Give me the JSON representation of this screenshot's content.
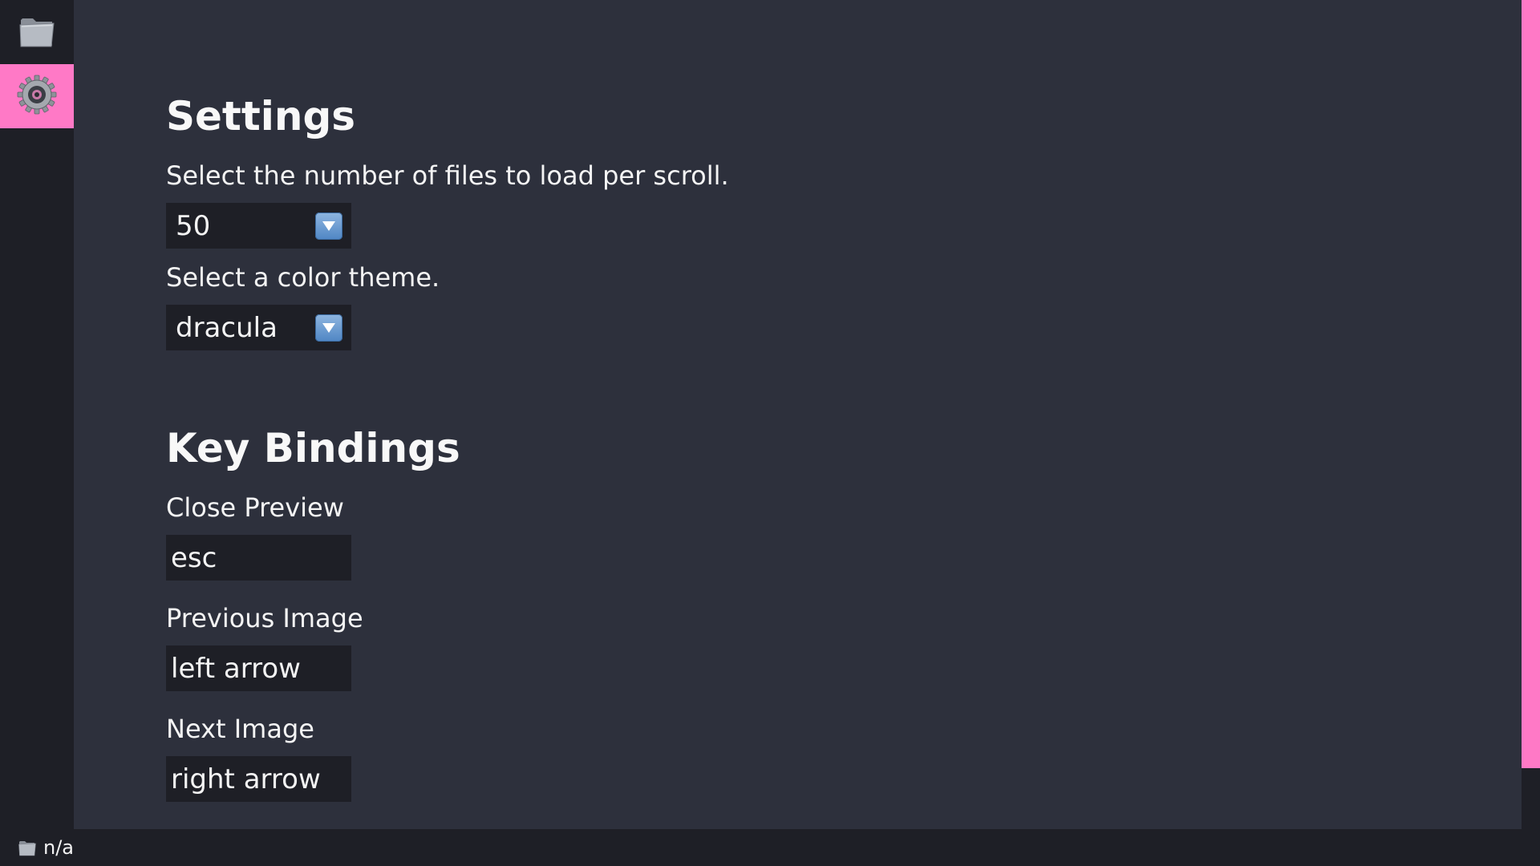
{
  "sidebar": {
    "items": [
      {
        "icon": "folder-icon"
      },
      {
        "icon": "gear-icon",
        "active": true
      }
    ]
  },
  "settings": {
    "title": "Settings",
    "files_per_scroll": {
      "label": "Select the number of files to load per scroll.",
      "value": "50"
    },
    "color_theme": {
      "label": "Select a color theme.",
      "value": "dracula"
    }
  },
  "key_bindings": {
    "title": "Key Bindings",
    "close_preview": {
      "label": "Close Preview",
      "value": "esc"
    },
    "previous_image": {
      "label": "Previous Image",
      "value": "left arrow"
    },
    "next_image": {
      "label": "Next Image",
      "value": "right arrow"
    }
  },
  "status_bar": {
    "icon": "folder-icon",
    "text": "n/a"
  },
  "colors": {
    "background": "#2d303c",
    "sidebar": "#1e1f26",
    "accent": "#ff79c6",
    "input_bg": "#1e1f26",
    "text": "#f4f4f4"
  }
}
